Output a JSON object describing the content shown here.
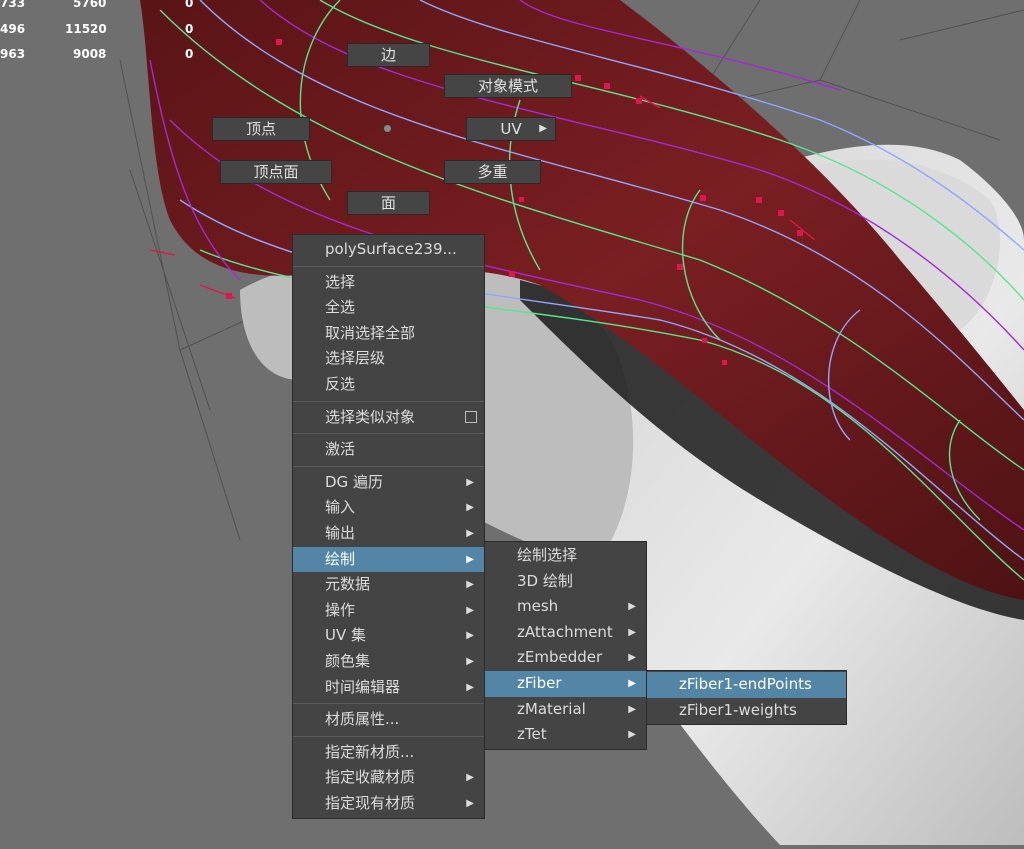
{
  "hud": [
    {
      "c1": "733",
      "c2": "5760",
      "c3": "0"
    },
    {
      "c1": "496",
      "c2": "11520",
      "c3": "0"
    },
    {
      "c1": "963",
      "c2": "9008",
      "c3": "0"
    }
  ],
  "marking_menu": {
    "edge": "边",
    "object_mode": "对象模式",
    "vertex": "顶点",
    "uv": "UV",
    "uv_arrow": "▶",
    "vertex_face": "顶点面",
    "multi": "多重",
    "face": "面"
  },
  "context_menu": {
    "header": "polySurface239...",
    "select": "选择",
    "select_all": "全选",
    "deselect_all": "取消选择全部",
    "select_hierarchy": "选择层级",
    "invert": "反选",
    "select_similar": "选择类似对象",
    "activate": "激活",
    "dg_traverse": "DG 遍历",
    "input": "输入",
    "output": "输出",
    "paint": "绘制",
    "metadata": "元数据",
    "actions": "操作",
    "uv_sets": "UV 集",
    "color_sets": "颜色集",
    "time_editor": "时间编辑器",
    "material_attrs": "材质属性...",
    "assign_new_material": "指定新材质...",
    "assign_fav_material": "指定收藏材质",
    "assign_existing_material": "指定现有材质",
    "arrow": "▶"
  },
  "paint_submenu": {
    "paint_select": "绘制选择",
    "paint_3d": "3D 绘制",
    "mesh": "mesh",
    "zattachment": "zAttachment",
    "zembedder": "zEmbedder",
    "zfiber": "zFiber",
    "zmaterial": "zMaterial",
    "ztet": "zTet"
  },
  "zfiber_submenu": {
    "end_points": "zFiber1-endPoints",
    "weights": "zFiber1-weights"
  },
  "colors": {
    "viewport_bg": "#6f6f6f",
    "muscle": "#6e1a1d",
    "menu_bg": "#444444",
    "highlight": "#5285a6",
    "curve_green": "#57e68f",
    "curve_purple": "#a32ad6",
    "curve_blue": "#8fa7ff",
    "point_red": "#e0164d"
  }
}
